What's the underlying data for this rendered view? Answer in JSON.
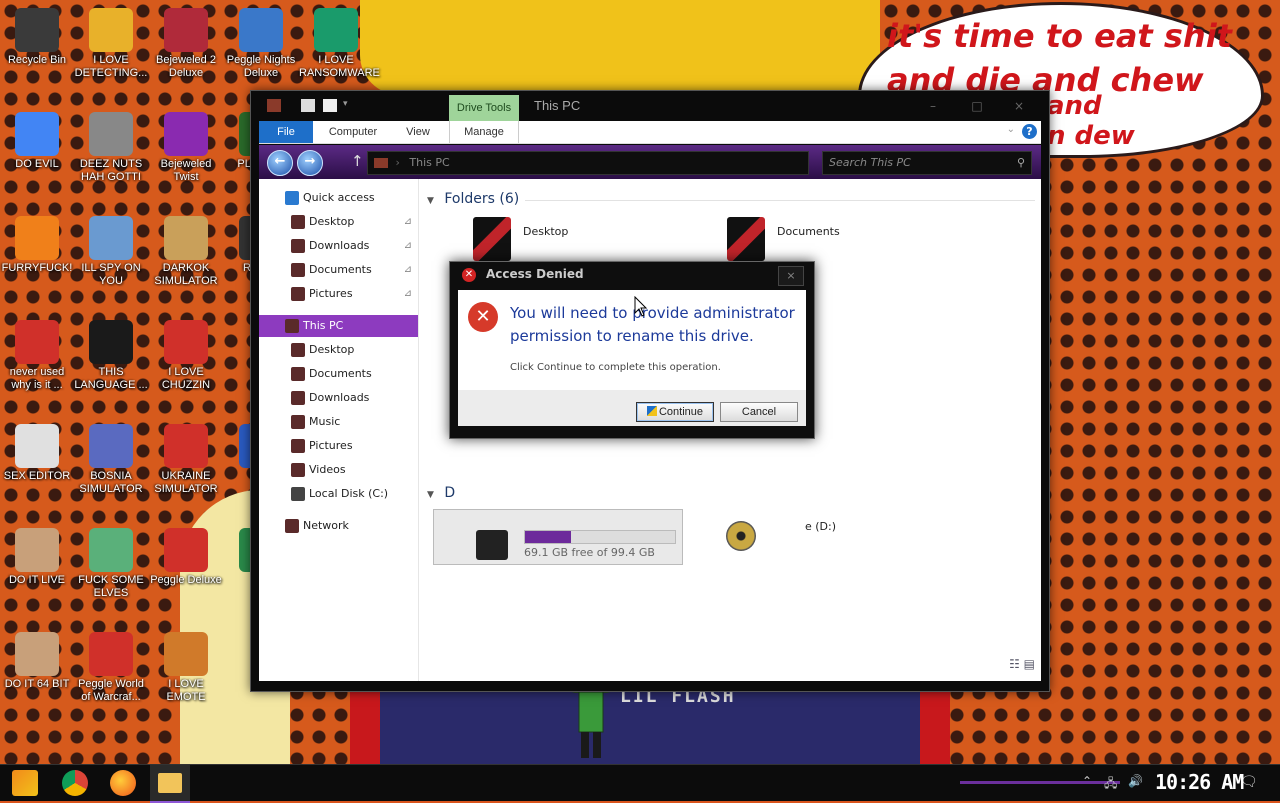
{
  "wallpaper": {
    "bubble_line1": "it's time to eat shit",
    "bubble_line2": "and die and chew",
    "bubble_line3": "and",
    "bubble_line4": "n dew",
    "sign_text": "LIL FLASH"
  },
  "desktop_icons": [
    {
      "label": "Recycle Bin",
      "icon": "recycle-bin-icon",
      "color": "#3a3a3a"
    },
    {
      "label": "I LOVE DETECTING...",
      "icon": "app-icon",
      "color": "#e8b12a"
    },
    {
      "label": "Bejeweled 2 Deluxe",
      "icon": "gem-icon",
      "color": "#b02a3a"
    },
    {
      "label": "Peggle Nights Deluxe",
      "icon": "peggle-icon",
      "color": "#3a78c9"
    },
    {
      "label": "I LOVE RANSOMWARE",
      "icon": "publisher-icon",
      "color": "#1a9b6b"
    },
    {
      "label": "DO EVIL",
      "icon": "chrome-icon",
      "color": "#4285f4"
    },
    {
      "label": "DEEZ NUTS HAH GOTTI",
      "icon": "copy-icon",
      "color": "#888"
    },
    {
      "label": "Bejeweled Twist",
      "icon": "gem-icon",
      "color": "#8a2ab0"
    },
    {
      "label": "PL METR",
      "icon": "app-icon",
      "color": "#2a6a2a"
    },
    {
      "label": "FURRYFUCK!",
      "icon": "firefox-icon",
      "color": "#f0801a"
    },
    {
      "label": "ILL SPY ON YOU",
      "icon": "network-icon",
      "color": "#6a9ad0"
    },
    {
      "label": "DARKOK SIMULATOR",
      "icon": "moneybag-icon",
      "color": "#c9a05a"
    },
    {
      "label": "Rock D",
      "icon": "app-icon",
      "color": "#333"
    },
    {
      "label": "never used why is it ...",
      "icon": "devcpp-icon",
      "color": "#d0302a"
    },
    {
      "label": "THIS LANGUAGE ...",
      "icon": "goland-icon",
      "color": "#1a1a1a"
    },
    {
      "label": "I LOVE CHUZZIN",
      "icon": "chuzzle-icon",
      "color": "#d0302a"
    },
    {
      "label": "SEX EDITOR",
      "icon": "hexeditor-icon",
      "color": "#e0e0e0"
    },
    {
      "label": "BOSNIA SIMULATOR",
      "icon": "mine-icon",
      "color": "#5a6ac0"
    },
    {
      "label": "UKRAINE SIMULATOR",
      "icon": "radiation-icon",
      "color": "#d0302a"
    },
    {
      "label": "I MA",
      "icon": "app-icon",
      "color": "#2a5ac0"
    },
    {
      "label": "DO IT LIVE",
      "icon": "portrait-icon",
      "color": "#c8a07a"
    },
    {
      "label": "FUCK SOME ELVES",
      "icon": "elf-icon",
      "color": "#5ab07a"
    },
    {
      "label": "Peggle Deluxe",
      "icon": "peggle-icon",
      "color": "#d0302a"
    },
    {
      "label": "MA",
      "icon": "app-icon",
      "color": "#2a8a4a"
    },
    {
      "label": "DO IT 64 BIT",
      "icon": "portrait-icon",
      "color": "#c8a07a"
    },
    {
      "label": "Peggle World of Warcraf...",
      "icon": "peggle-icon",
      "color": "#d0302a"
    },
    {
      "label": "I LOVE EMOTE",
      "icon": "app-icon",
      "color": "#d07a2a"
    }
  ],
  "explorer": {
    "title": "This PC",
    "drive_tools": "Drive Tools",
    "ribbon_tabs": [
      "File",
      "Computer",
      "View",
      "Manage"
    ],
    "help": "?",
    "path": "This PC",
    "search_placeholder": "Search This PC",
    "nav": [
      {
        "label": "Quick access",
        "icon": "star-icon",
        "color": "#2a7ad0",
        "pinned": false
      },
      {
        "label": "Desktop",
        "icon": "folder-icon",
        "color": "#5a2a2a",
        "pinned": true
      },
      {
        "label": "Downloads",
        "icon": "folder-icon",
        "color": "#5a2a2a",
        "pinned": true
      },
      {
        "label": "Documents",
        "icon": "folder-icon",
        "color": "#5a2a2a",
        "pinned": true
      },
      {
        "label": "Pictures",
        "icon": "folder-icon",
        "color": "#5a2a2a",
        "pinned": true
      },
      {
        "label": "This PC",
        "icon": "computer-icon",
        "color": "#5a2a2a",
        "pinned": false
      },
      {
        "label": "Desktop",
        "icon": "folder-icon",
        "color": "#5a2a2a",
        "pinned": false
      },
      {
        "label": "Documents",
        "icon": "folder-icon",
        "color": "#5a2a2a",
        "pinned": false
      },
      {
        "label": "Downloads",
        "icon": "folder-icon",
        "color": "#5a2a2a",
        "pinned": false
      },
      {
        "label": "Music",
        "icon": "folder-icon",
        "color": "#5a2a2a",
        "pinned": false
      },
      {
        "label": "Pictures",
        "icon": "folder-icon",
        "color": "#5a2a2a",
        "pinned": false
      },
      {
        "label": "Videos",
        "icon": "folder-icon",
        "color": "#5a2a2a",
        "pinned": false
      },
      {
        "label": "Local Disk (C:)",
        "icon": "drive-icon",
        "color": "#444",
        "pinned": false
      },
      {
        "label": "Network",
        "icon": "network-icon",
        "color": "#5a2a2a",
        "pinned": false
      }
    ],
    "folders_header": "Folders (6)",
    "folders": [
      {
        "label": "Desktop",
        "icon": "folder-icon"
      },
      {
        "label": "Documents",
        "icon": "folder-icon"
      }
    ],
    "devices_header_partial": "D",
    "drive_c": {
      "free_text": "69.1 GB free of 99.4 GB",
      "used_fraction": 0.305
    },
    "drive_d_label": "e (D:)",
    "pin_glyph": "📌"
  },
  "dialog": {
    "title": "Access Denied",
    "close": "×",
    "message": "You will need to provide administrator permission to rename this drive.",
    "sub": "Click Continue to complete this operation.",
    "continue_label": "Continue",
    "cancel_label": "Cancel"
  },
  "taskbar": {
    "clock": "10:26 AM",
    "apps": [
      "start-icon",
      "chrome-icon",
      "firefox-icon",
      "file-explorer-icon"
    ]
  }
}
